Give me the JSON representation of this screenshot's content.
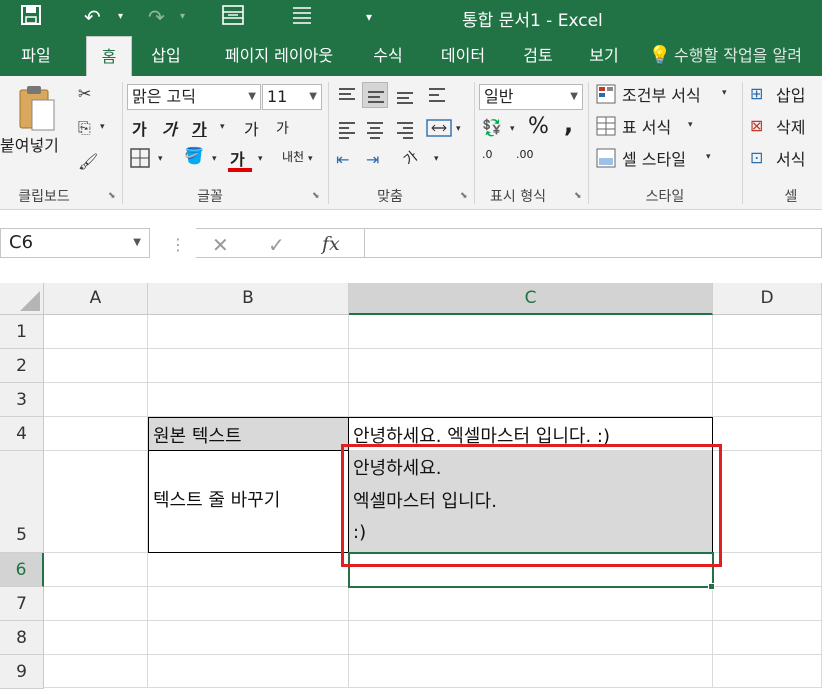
{
  "app": {
    "title": "통합 문서1 - Excel",
    "accent": "#217346",
    "highlight_color": "#e02020"
  },
  "quick_access": {
    "save_icon": "save-icon",
    "undo_icon": "undo-icon",
    "redo_icon": "redo-icon",
    "form_icon": "form-icon",
    "list_icon": "list-icon",
    "customize_icon": "customize-icon"
  },
  "tabs": [
    {
      "label": "파일"
    },
    {
      "label": "홈",
      "active": true
    },
    {
      "label": "삽입"
    },
    {
      "label": "페이지 레이아웃"
    },
    {
      "label": "수식"
    },
    {
      "label": "데이터"
    },
    {
      "label": "검토"
    },
    {
      "label": "보기"
    },
    {
      "label": "수행할 작업을 알려"
    }
  ],
  "ribbon": {
    "clipboard": {
      "label": "클립보드",
      "paste": "붙여넣기"
    },
    "font": {
      "label": "글꼴",
      "font_name": "맑은 고딕",
      "font_size": "11",
      "bold": "가",
      "italic": "가",
      "underline": "가",
      "grow": "가",
      "shrink": "가",
      "font_color": "가",
      "phonetic": "내천"
    },
    "alignment": {
      "label": "맞춤",
      "orientation": "가"
    },
    "number": {
      "label": "표시 형식",
      "format": "일반",
      "percent": "%",
      "comma": ",",
      "inc_decimal": ".0",
      "dec_decimal": ".00"
    },
    "styles": {
      "label": "스타일",
      "conditional": "조건부 서식",
      "table": "표 서식",
      "cell_styles": "셀 스타일"
    },
    "cells": {
      "label": "셀",
      "insert": "삽입",
      "delete": "삭제",
      "format": "서식"
    }
  },
  "formula_bar": {
    "name_box": "C6",
    "cancel": "✕",
    "enter": "✓",
    "fx": "fx",
    "value": ""
  },
  "sheet": {
    "columns": [
      "A",
      "B",
      "C",
      "D"
    ],
    "selected_column": "C",
    "rows": [
      "1",
      "2",
      "3",
      "4",
      "5",
      "6",
      "7",
      "8",
      "9"
    ],
    "selected_row": "6",
    "active_cell": "C6",
    "cells": {
      "B4": "원본 텍스트",
      "C4": "안녕하세요. 엑셀마스터 입니다. :)",
      "B5": "텍스트 줄 바꾸기",
      "C5_lines": [
        "안녕하세요.",
        "엑셀마스터 입니다.",
        ":)"
      ]
    }
  }
}
